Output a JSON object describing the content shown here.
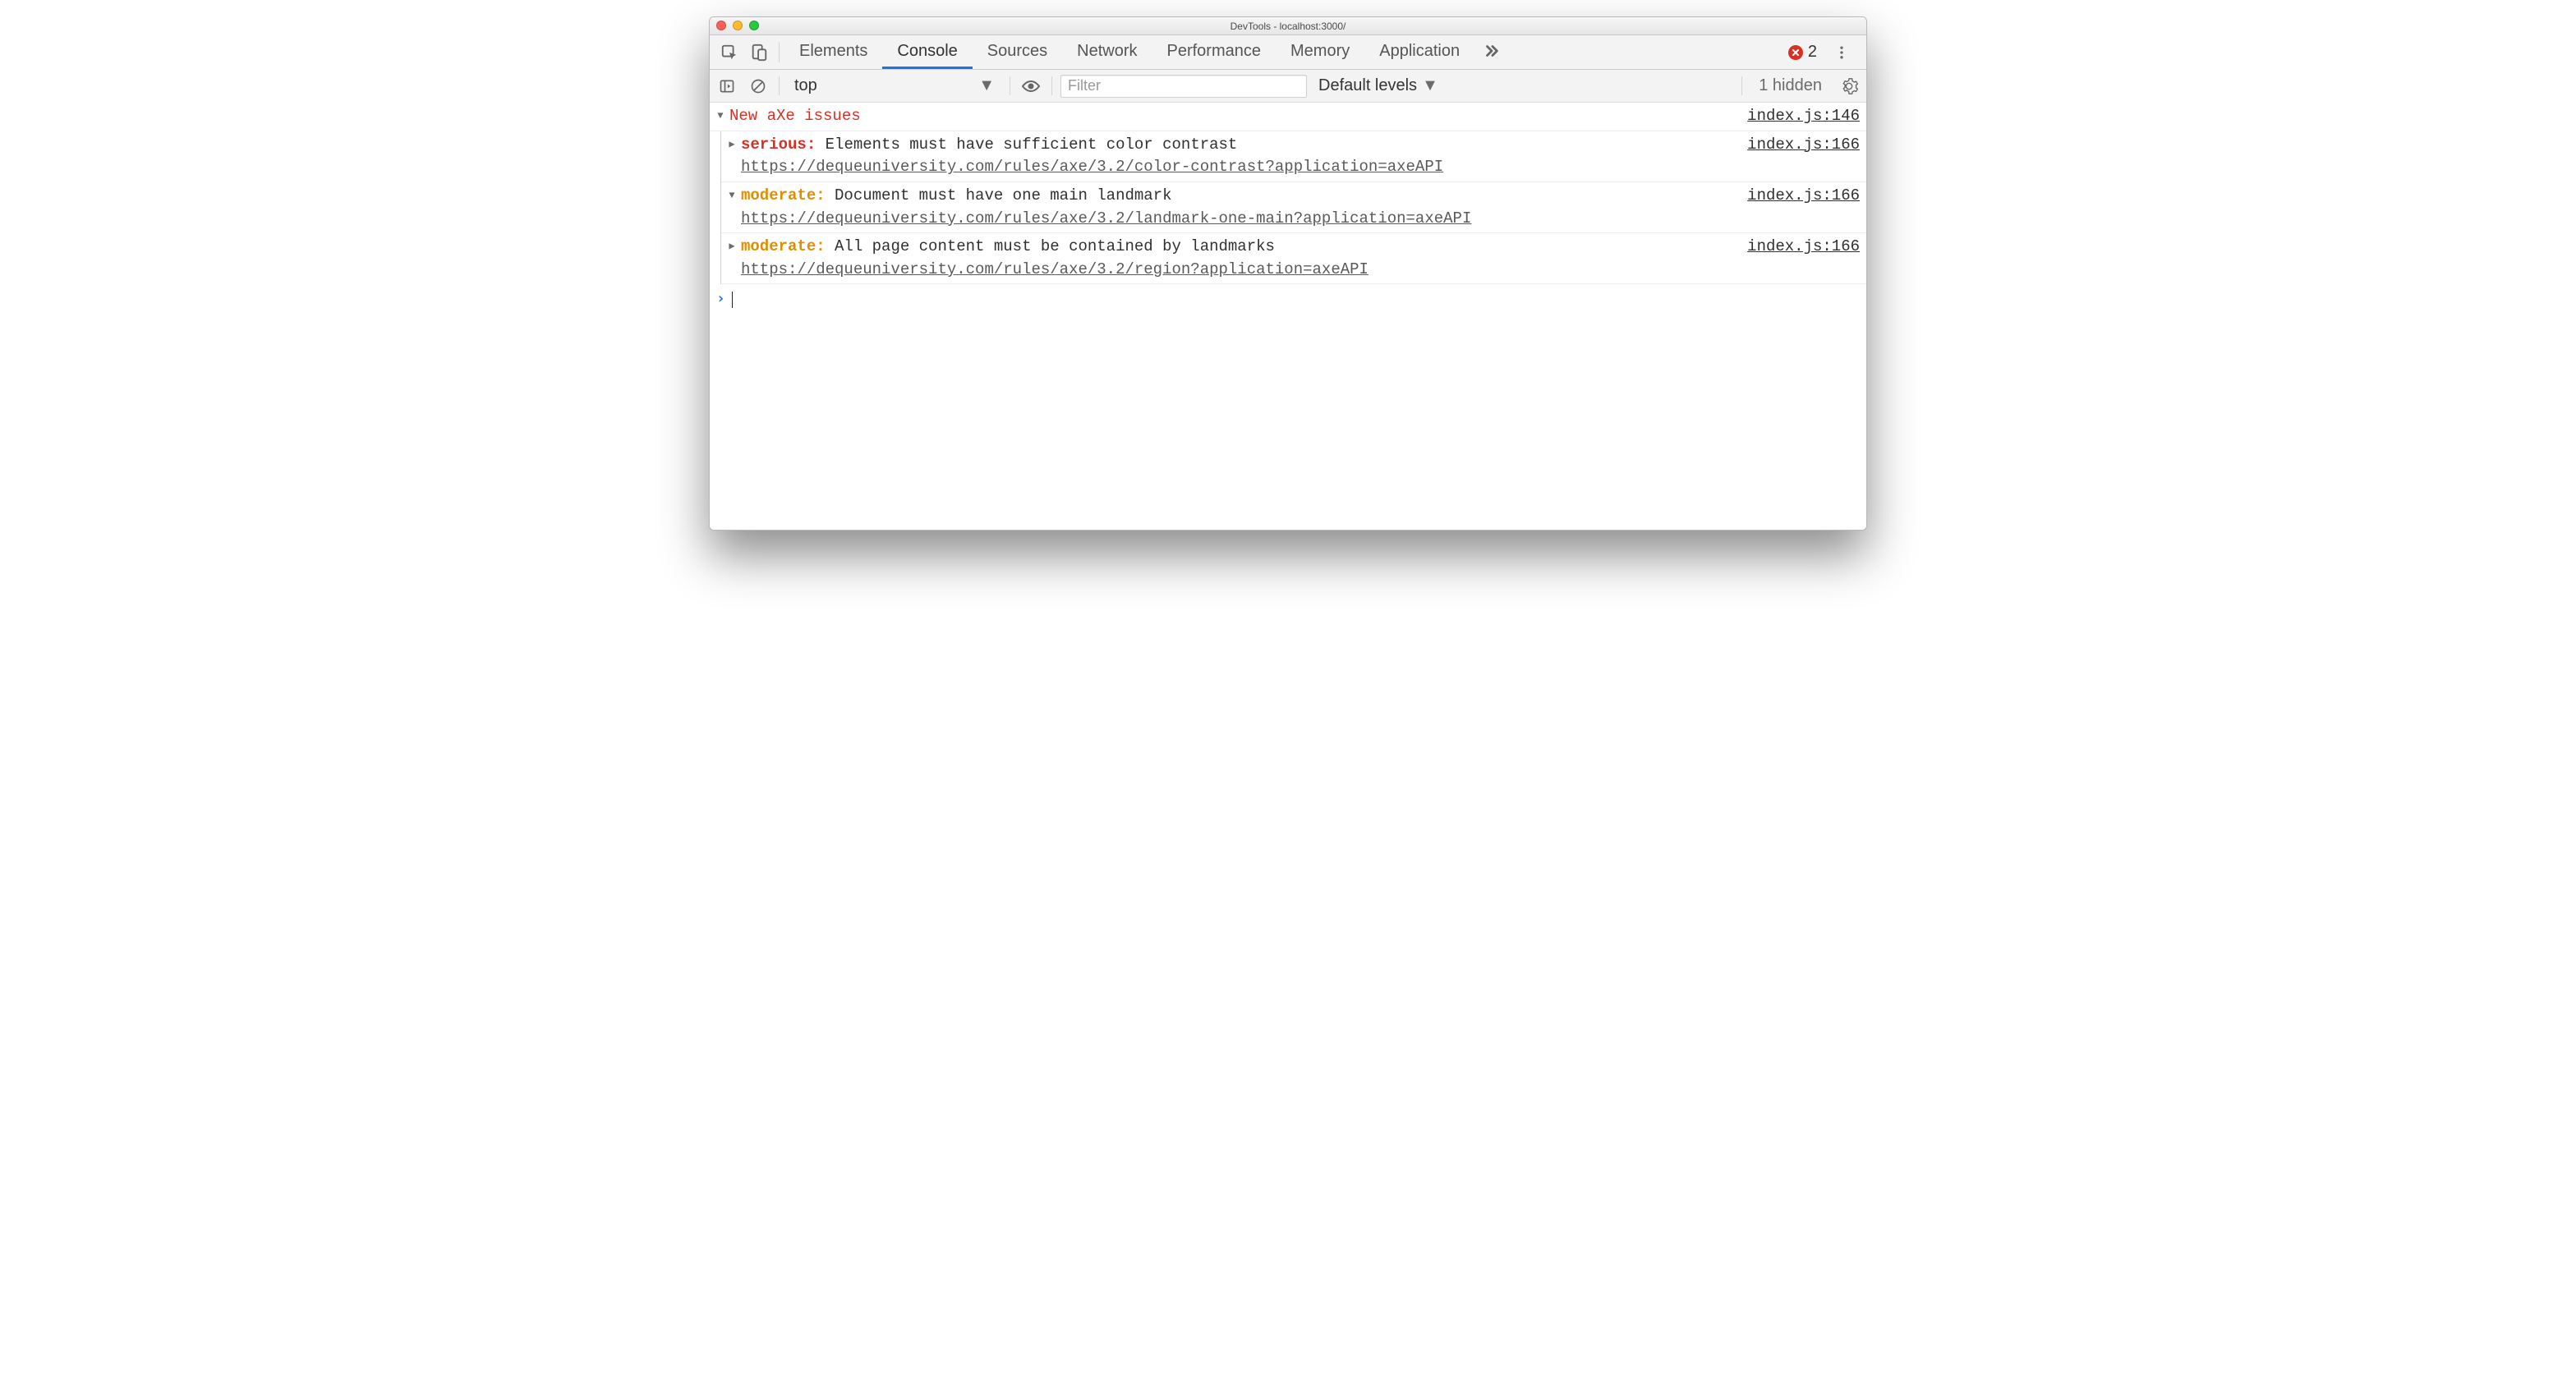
{
  "window": {
    "title": "DevTools - localhost:3000/"
  },
  "tabs": {
    "items": [
      "Elements",
      "Console",
      "Sources",
      "Network",
      "Performance",
      "Memory",
      "Application"
    ],
    "activeIndex": 1
  },
  "errorBadge": {
    "count": "2"
  },
  "toolbar": {
    "context": "top",
    "filterPlaceholder": "Filter",
    "levelsLabel": "Default levels",
    "hiddenLabel": "1 hidden"
  },
  "group": {
    "title": "New aXe issues",
    "source": "index.js:146"
  },
  "issues": [
    {
      "expanded": false,
      "severity": "serious",
      "message": "Elements must have sufficient color contrast",
      "url": "https://dequeuniversity.com/rules/axe/3.2/color-contrast?application=axeAPI",
      "source": "index.js:166"
    },
    {
      "expanded": true,
      "severity": "moderate",
      "message": "Document must have one main landmark",
      "url": "https://dequeuniversity.com/rules/axe/3.2/landmark-one-main?application=axeAPI",
      "source": "index.js:166"
    },
    {
      "expanded": false,
      "severity": "moderate",
      "message": "All page content must be contained by landmarks",
      "url": "https://dequeuniversity.com/rules/axe/3.2/region?application=axeAPI",
      "source": "index.js:166"
    }
  ]
}
